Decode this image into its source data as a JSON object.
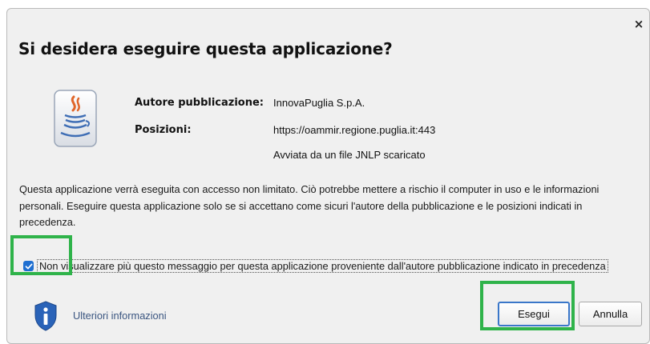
{
  "dialog": {
    "title": "Si desidera eseguire questa applicazione?",
    "close_glyph": "×",
    "publisher_label": "Autore pubblicazione:",
    "publisher_value": "InnovaPuglia S.p.A.",
    "locations_label": "Posizioni:",
    "location_url": "https://oammir.regione.puglia.it:443",
    "location_note": "Avviata da un file JNLP scaricato",
    "warning_lines": [
      "Questa applicazione verrà eseguita con accesso non limitato. Ciò potrebbe mettere a rischio il computer in uso e le informazioni",
      "personali. Eseguire questa applicazione solo se si accettano come sicuri l'autore della pubblicazione e le posizioni indicati in",
      "precedenza."
    ],
    "checkbox_label": "Non visualizzare più questo messaggio per questa applicazione proveniente dall'autore pubblicazione indicato in precedenza",
    "checkbox_checked": true,
    "more_info_link": "Ulteriori informazioni",
    "run_button": "Esegui",
    "cancel_button": "Annulla"
  },
  "colors": {
    "highlight": "#2fb34a",
    "checkbox": "#1f6fd1",
    "link": "#3a5580",
    "shield": "#2a63b8"
  },
  "icons": {
    "app": "java-coffee-cup-icon",
    "info": "shield-info-icon",
    "close": "close-icon"
  }
}
